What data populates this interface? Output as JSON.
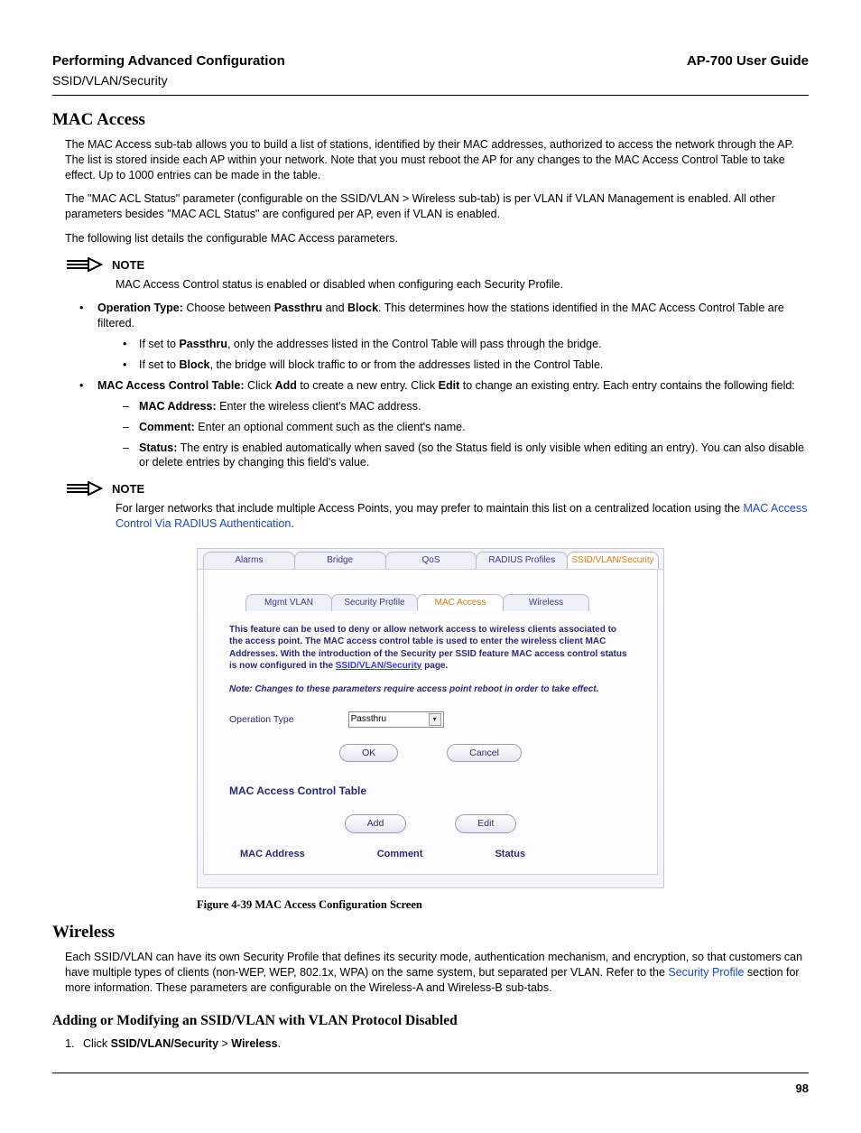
{
  "header": {
    "left": "Performing Advanced Configuration",
    "right": "AP-700 User Guide",
    "sub": "SSID/VLAN/Security"
  },
  "sec1": {
    "title": "MAC Access",
    "p1": "The MAC Access sub-tab allows you to build a list of stations, identified by their MAC addresses, authorized to access the network through the AP. The list is stored inside each AP within your network. Note that you must reboot the AP for any changes to the MAC Access Control Table to take effect. Up to 1000 entries can be made in the table.",
    "p2": "The \"MAC ACL Status\" parameter (configurable on the SSID/VLAN > Wireless sub-tab) is per VLAN if VLAN Management is enabled. All other parameters besides \"MAC ACL Status\" are configured per AP, even if VLAN is enabled.",
    "p3": "The following list details the configurable MAC Access parameters."
  },
  "note1": {
    "label": "NOTE",
    "text": "MAC Access Control status is enabled or disabled when configuring each Security Profile."
  },
  "bullets": {
    "b1_lead": "Operation Type:",
    "b1_rest_a": " Choose between ",
    "b1_passthru": "Passthru",
    "b1_and": " and ",
    "b1_block": "Block",
    "b1_rest_b": ". This determines how the stations identified in the MAC Access Control Table are filtered.",
    "b1s1_a": "If set to ",
    "b1s1_b": "Passthru",
    "b1s1_c": ", only the addresses listed in the Control Table will pass through the bridge.",
    "b1s2_a": "If set to ",
    "b1s2_b": "Block",
    "b1s2_c": ", the bridge will block traffic to or from the addresses listed in the Control Table.",
    "b2_lead": "MAC Access Control Table:",
    "b2_rest_a": " Click ",
    "b2_add": "Add",
    "b2_rest_b": " to create a new entry. Click ",
    "b2_edit": "Edit",
    "b2_rest_c": " to change an existing entry. Each entry contains the following field:",
    "b2s1_lead": "MAC Address:",
    "b2s1_rest": " Enter the wireless client's MAC address.",
    "b2s2_lead": "Comment:",
    "b2s2_rest": " Enter an optional comment such as the client's name.",
    "b2s3_lead": "Status:",
    "b2s3_rest": " The entry is enabled automatically when saved (so the Status field is only visible when editing an entry). You can also disable or delete entries by changing this field's value."
  },
  "note2": {
    "label": "NOTE",
    "text_a": "For larger networks that include multiple Access Points, you may prefer to maintain this list on a centralized location using the ",
    "link": "MAC Access Control Via RADIUS Authentication",
    "text_b": "."
  },
  "ui": {
    "tabs_top": [
      "Alarms",
      "Bridge",
      "QoS",
      "RADIUS Profiles",
      "SSID/VLAN/Security"
    ],
    "tabs_top_active": 4,
    "tabs_sub": [
      "Mgmt VLAN",
      "Security Profile",
      "MAC Access",
      "Wireless"
    ],
    "tabs_sub_active": 2,
    "desc_a": "This feature can be used to deny or allow network access to wireless clients associated to the access point. The MAC access control table is used to enter the wireless client MAC Addresses. With the introduction of the Security per SSID feature MAC access control status is now configured in the ",
    "desc_link": "SSID/VLAN/Security",
    "desc_b": " page.",
    "note": "Note: Changes to these parameters require access point reboot in order to take effect.",
    "op_label": "Operation Type",
    "op_value": "Passthru",
    "btn_ok": "OK",
    "btn_cancel": "Cancel",
    "table_h": "MAC Access Control Table",
    "btn_add": "Add",
    "btn_edit": "Edit",
    "col1": "MAC Address",
    "col2": "Comment",
    "col3": "Status"
  },
  "fig_cap": "Figure 4-39    MAC Access Configuration Screen",
  "sec2": {
    "title": "Wireless",
    "p_a": "Each SSID/VLAN can have its own Security Profile that defines its security mode, authentication mechanism, and encryption, so that customers can have multiple types of clients (non-WEP, WEP, 802.1x, WPA) on the same system, but separated per VLAN. Refer to the ",
    "p_link": "Security Profile",
    "p_b": " section for more information. These parameters are configurable on the Wireless-A and Wireless-B sub-tabs."
  },
  "sec3": {
    "title": "Adding or Modifying an SSID/VLAN with VLAN Protocol Disabled",
    "step_a": "Click ",
    "step_b": "SSID/VLAN/Security",
    "step_c": " > ",
    "step_d": "Wireless",
    "step_e": "."
  },
  "page_num": "98"
}
